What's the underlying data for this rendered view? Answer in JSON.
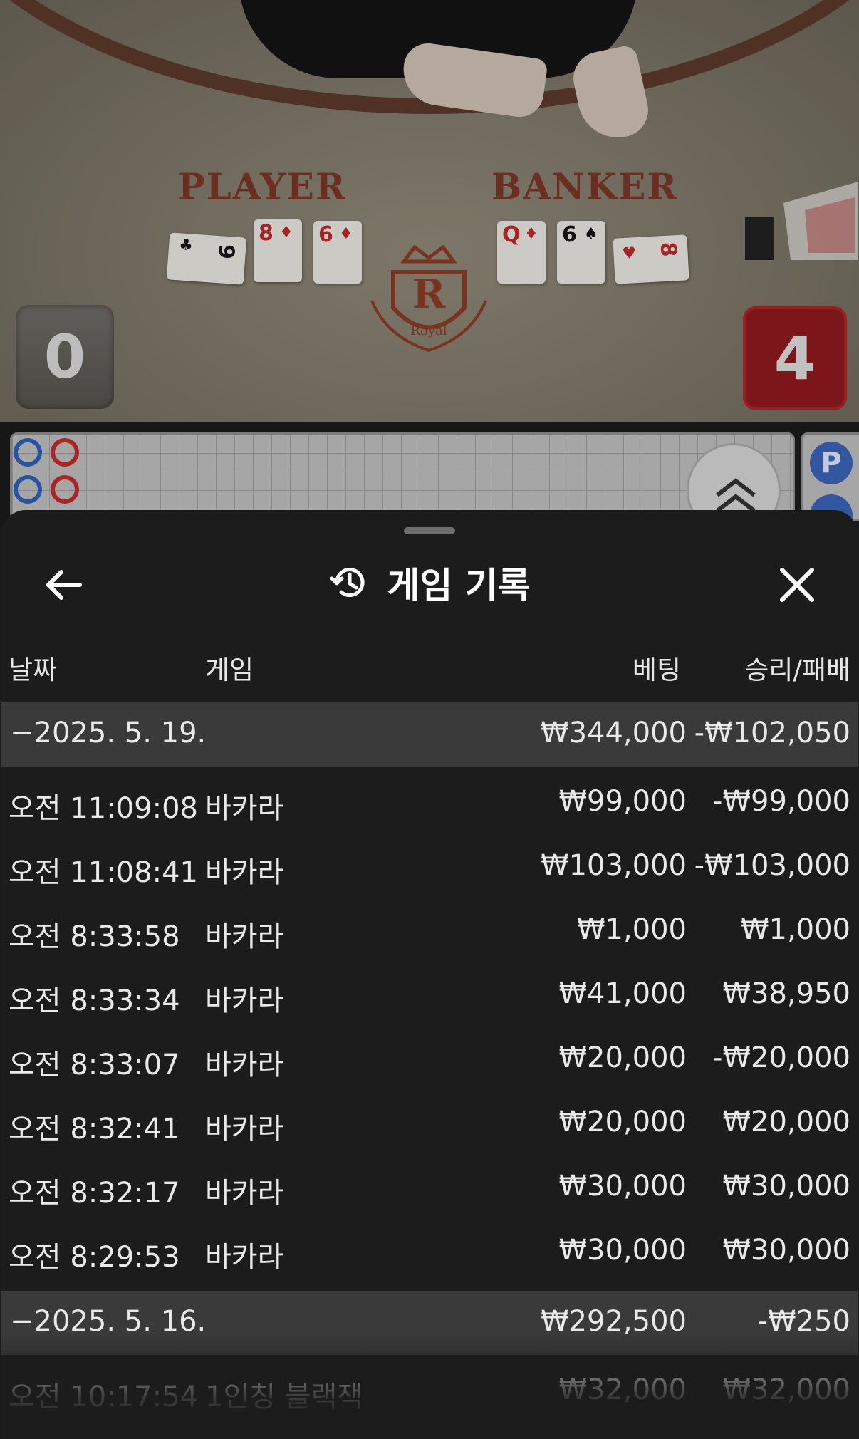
{
  "table": {
    "player_label": "PLAYER",
    "banker_label": "BANKER",
    "player_score": "0",
    "banker_score": "4",
    "emblem_letter": "R",
    "emblem_text": "Royal",
    "player_cards": [
      {
        "rank": "9",
        "suit": "♣",
        "color": "blk"
      },
      {
        "rank": "8",
        "suit": "♦",
        "color": "red"
      },
      {
        "rank": "6",
        "suit": "♦",
        "color": "red"
      }
    ],
    "banker_cards": [
      {
        "rank": "Q",
        "suit": "♦",
        "color": "red"
      },
      {
        "rank": "6",
        "suit": "♠",
        "color": "blk"
      },
      {
        "rank": "8",
        "suit": "♥",
        "color": "red"
      }
    ],
    "side_chip_label": "P"
  },
  "sheet": {
    "title": "게임 기록",
    "columns": {
      "date": "날짜",
      "game": "게임",
      "bet": "베팅",
      "winloss": "승리/패배"
    },
    "groups": [
      {
        "date": "−2025. 5. 19.",
        "bet": "₩344,000",
        "winloss": "-₩102,050",
        "rows": [
          {
            "time": "오전 11:09:08",
            "game": "바카라",
            "bet": "₩99,000",
            "winloss": "-₩99,000"
          },
          {
            "time": "오전 11:08:41",
            "game": "바카라",
            "bet": "₩103,000",
            "winloss": "-₩103,000"
          },
          {
            "time": "오전 8:33:58",
            "game": "바카라",
            "bet": "₩1,000",
            "winloss": "₩1,000"
          },
          {
            "time": "오전 8:33:34",
            "game": "바카라",
            "bet": "₩41,000",
            "winloss": "₩38,950"
          },
          {
            "time": "오전 8:33:07",
            "game": "바카라",
            "bet": "₩20,000",
            "winloss": "-₩20,000"
          },
          {
            "time": "오전 8:32:41",
            "game": "바카라",
            "bet": "₩20,000",
            "winloss": "₩20,000"
          },
          {
            "time": "오전 8:32:17",
            "game": "바카라",
            "bet": "₩30,000",
            "winloss": "₩30,000"
          },
          {
            "time": "오전 8:29:53",
            "game": "바카라",
            "bet": "₩30,000",
            "winloss": "₩30,000"
          }
        ]
      },
      {
        "date": "−2025. 5. 16.",
        "bet": "₩292,500",
        "winloss": "-₩250",
        "rows": [
          {
            "time": "오전 10:17:54",
            "game": "1인칭 블랙잭",
            "bet": "₩32,000",
            "winloss": "₩32,000"
          }
        ]
      }
    ]
  },
  "colors": {
    "sheet_bg": "#1c1c1c",
    "group_row_bg": "#3a3a3a",
    "banker_red": "#8e1a1e",
    "player_blue": "#3a63b8"
  }
}
